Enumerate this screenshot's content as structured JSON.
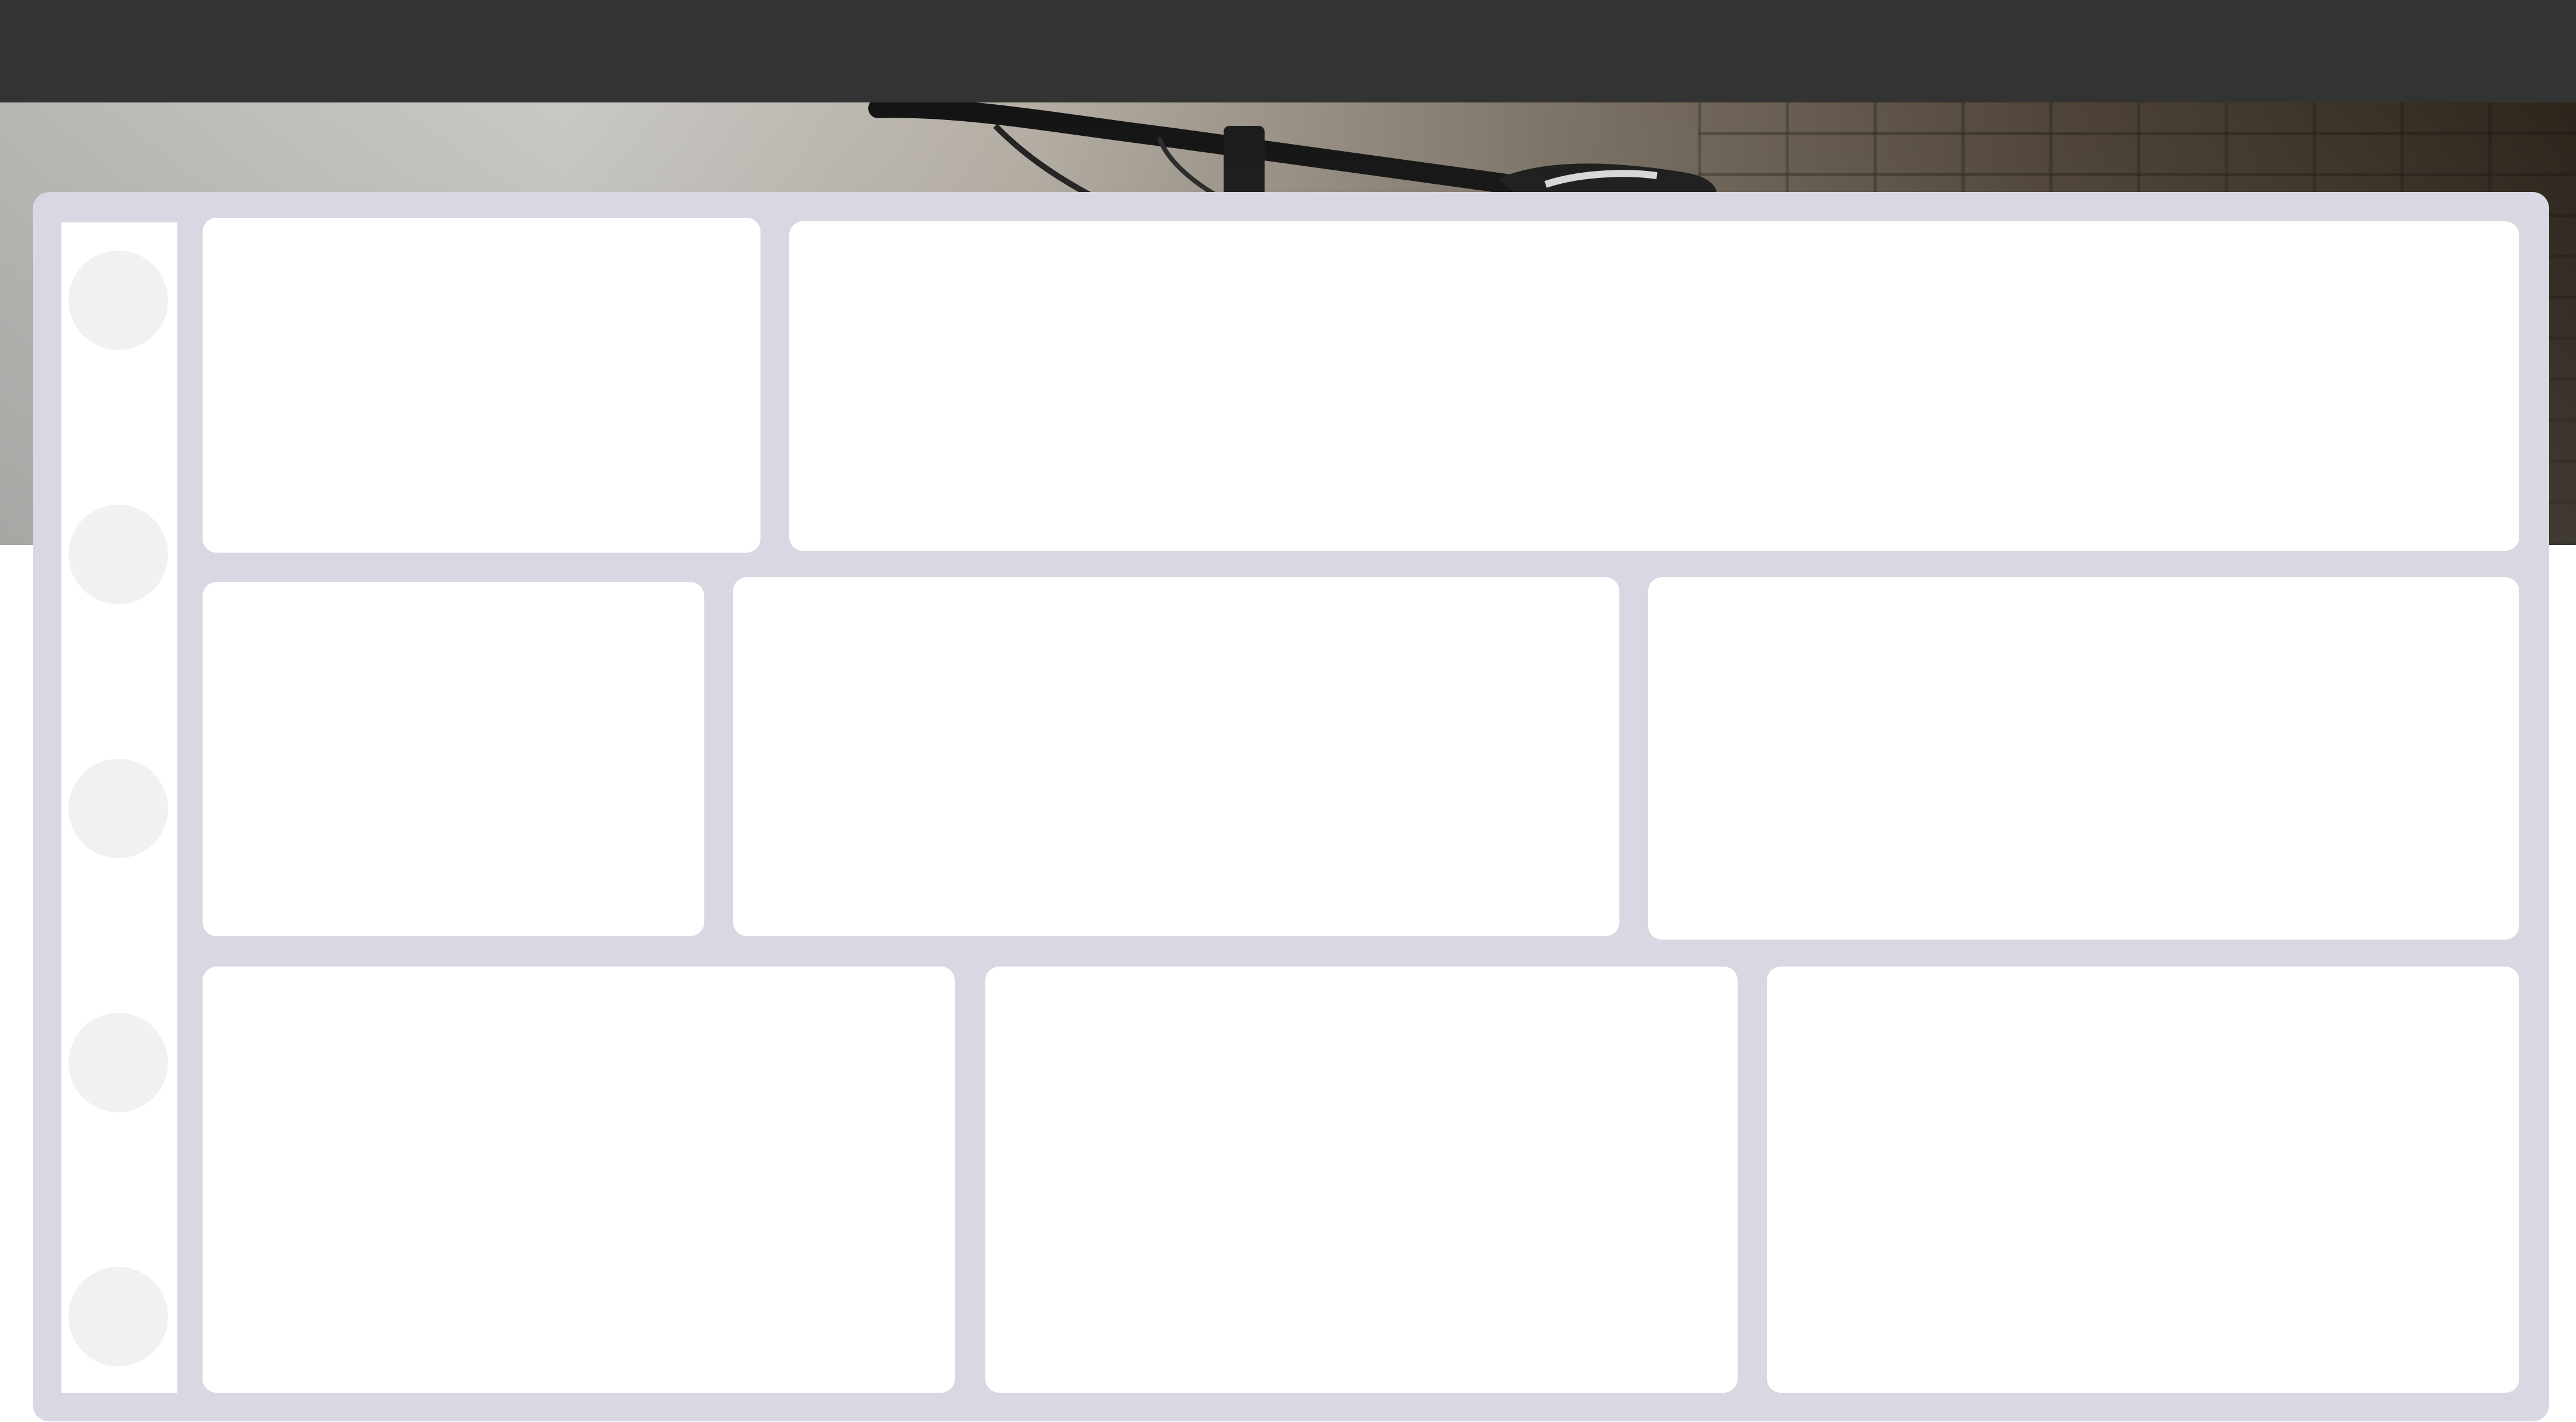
{
  "colors": {
    "topbar": "#333333",
    "frame": "#d7d8e2",
    "card": "#ffffff",
    "placeholder_dot": "#f1f1f1"
  },
  "hero": {
    "image": "bicycle-handlebar-photo"
  },
  "sidebar": {
    "items": [
      "avatar-placeholder",
      "avatar-placeholder",
      "avatar-placeholder",
      "avatar-placeholder",
      "avatar-placeholder"
    ]
  },
  "tiles": {
    "row1": [
      "empty",
      "empty"
    ],
    "row2": [
      "empty",
      "empty",
      "empty"
    ],
    "row3": [
      "empty",
      "empty",
      "empty"
    ]
  }
}
